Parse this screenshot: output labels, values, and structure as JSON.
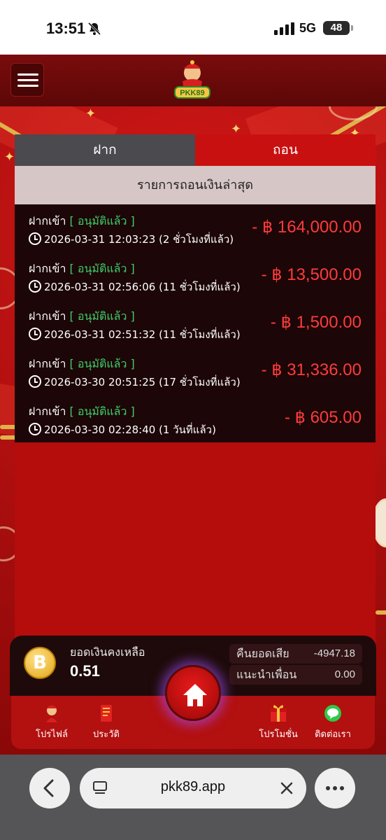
{
  "status_bar": {
    "time": "13:51",
    "network": "5G",
    "battery": "48"
  },
  "header": {
    "logo_text": "PKK89"
  },
  "tabs": {
    "deposit": "ฝาก",
    "withdraw": "ถอน"
  },
  "list_title": "รายการถอนเงินล่าสุด",
  "transactions": [
    {
      "type": "ฝากเข้า",
      "status": "[ อนุมัติแล้ว ]",
      "datetime": "2026-03-31 12:03:23 (2 ชั่วโมงที่แล้ว)",
      "amount": "- ฿ 164,000.00"
    },
    {
      "type": "ฝากเข้า",
      "status": "[ อนุมัติแล้ว ]",
      "datetime": "2026-03-31 02:56:06 (11 ชั่วโมงที่แล้ว)",
      "amount": "- ฿ 13,500.00"
    },
    {
      "type": "ฝากเข้า",
      "status": "[ อนุมัติแล้ว ]",
      "datetime": "2026-03-31 02:51:32 (11 ชั่วโมงที่แล้ว)",
      "amount": "- ฿ 1,500.00"
    },
    {
      "type": "ฝากเข้า",
      "status": "[ อนุมัติแล้ว ]",
      "datetime": "2026-03-30 20:51:25 (17 ชั่วโมงที่แล้ว)",
      "amount": "- ฿ 31,336.00"
    },
    {
      "type": "ฝากเข้า",
      "status": "[ อนุมัติแล้ว ]",
      "datetime": "2026-03-30 02:28:40 (1 วันที่แล้ว)",
      "amount": "- ฿ 605.00"
    }
  ],
  "balance": {
    "label": "ยอดเงินคงเหลือ",
    "value": "0.51",
    "coin_symbol": "B"
  },
  "stats": {
    "cashback_label": "คืนยอดเสีย",
    "cashback_value": "-4947.18",
    "referral_label": "แนะนำเพื่อน",
    "referral_value": "0.00"
  },
  "nav": {
    "profile": "โปรไฟล์",
    "history": "ประวัติ",
    "promotion": "โปรโมชั่น",
    "contact": "ติดต่อเรา"
  },
  "browser": {
    "url": "pkk89.app"
  },
  "colors": {
    "amount": "#ff3b3b",
    "status": "#3fcf6a",
    "brand_red": "#b50c0c"
  }
}
